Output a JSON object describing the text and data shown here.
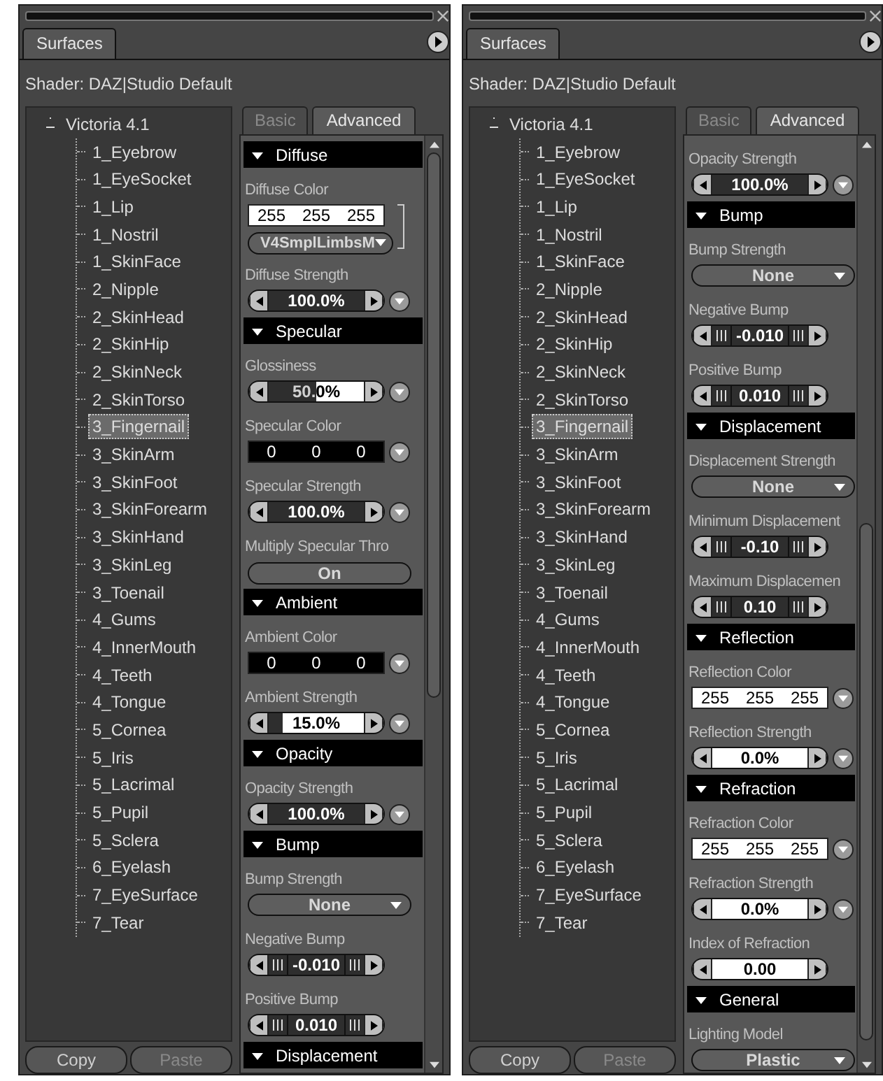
{
  "panels": [
    {
      "tab": {
        "label": "Surfaces",
        "selected": true
      },
      "shader": "Shader: DAZ|Studio Default",
      "tree": [
        {
          "label": "Victoria 4.1",
          "expanded": true,
          "selected": false,
          "children": [
            {
              "label": "1_Eyebrow",
              "selected": false
            },
            {
              "label": "1_EyeSocket",
              "selected": false
            },
            {
              "label": "1_Lip",
              "selected": false
            },
            {
              "label": "1_Nostril",
              "selected": false
            },
            {
              "label": "1_SkinFace",
              "selected": false
            },
            {
              "label": "2_Nipple",
              "selected": false
            },
            {
              "label": "2_SkinHead",
              "selected": false
            },
            {
              "label": "2_SkinHip",
              "selected": false
            },
            {
              "label": "2_SkinNeck",
              "selected": false
            },
            {
              "label": "2_SkinTorso",
              "selected": false
            },
            {
              "label": "3_Fingernail",
              "selected": true
            },
            {
              "label": "3_SkinArm",
              "selected": false
            },
            {
              "label": "3_SkinFoot",
              "selected": false
            },
            {
              "label": "3_SkinForearm",
              "selected": false
            },
            {
              "label": "3_SkinHand",
              "selected": false
            },
            {
              "label": "3_SkinLeg",
              "selected": false
            },
            {
              "label": "3_Toenail",
              "selected": false
            },
            {
              "label": "4_Gums",
              "selected": false
            },
            {
              "label": "4_InnerMouth",
              "selected": false
            },
            {
              "label": "4_Teeth",
              "selected": false
            },
            {
              "label": "4_Tongue",
              "selected": false
            },
            {
              "label": "5_Cornea",
              "selected": false
            },
            {
              "label": "5_Iris",
              "selected": false
            },
            {
              "label": "5_Lacrimal",
              "selected": false
            },
            {
              "label": "5_Pupil",
              "selected": false
            },
            {
              "label": "5_Sclera",
              "selected": false
            },
            {
              "label": "6_Eyelash",
              "selected": false
            },
            {
              "label": "7_EyeSurface",
              "selected": false
            },
            {
              "label": "7_Tear",
              "selected": false
            }
          ]
        }
      ],
      "prop_tabs": [
        {
          "label": "Basic",
          "selected": false
        },
        {
          "label": "Advanced",
          "selected": true
        }
      ],
      "properties": [
        {
          "kind": "section",
          "label": "Diffuse",
          "expanded": true
        },
        {
          "kind": "label",
          "label": "Diffuse Color"
        },
        {
          "kind": "color",
          "values": [
            "255",
            "255",
            "255"
          ],
          "color": "#ffffff",
          "menu": false
        },
        {
          "kind": "map",
          "value": "V4SmplLimbsM"
        },
        {
          "kind": "label",
          "label": "Diffuse Strength"
        },
        {
          "kind": "slider",
          "value": "100.0%",
          "level": 1,
          "menu": true
        },
        {
          "kind": "section",
          "label": "Specular",
          "expanded": true
        },
        {
          "kind": "label",
          "label": "Glossiness"
        },
        {
          "kind": "slider",
          "value": "50.0%",
          "level": 0.5,
          "menu": true
        },
        {
          "kind": "label",
          "label": "Specular Color"
        },
        {
          "kind": "color",
          "values": [
            "0",
            "0",
            "0"
          ],
          "color": "#000000",
          "menu": true
        },
        {
          "kind": "label",
          "label": "Specular Strength"
        },
        {
          "kind": "slider",
          "value": "100.0%",
          "level": 1,
          "menu": true
        },
        {
          "kind": "label",
          "label": "Multiply Specular Thro"
        },
        {
          "kind": "toggle",
          "value": "On"
        },
        {
          "kind": "section",
          "label": "Ambient",
          "expanded": true
        },
        {
          "kind": "label",
          "label": "Ambient Color"
        },
        {
          "kind": "color",
          "values": [
            "0",
            "0",
            "0"
          ],
          "color": "#000000",
          "menu": true
        },
        {
          "kind": "label",
          "label": "Ambient Strength"
        },
        {
          "kind": "slider",
          "value": "15.0%",
          "level": 0.15,
          "menu": true
        },
        {
          "kind": "section",
          "label": "Opacity",
          "expanded": true
        },
        {
          "kind": "label",
          "label": "Opacity Strength"
        },
        {
          "kind": "slider",
          "value": "100.0%",
          "level": 1,
          "menu": true
        },
        {
          "kind": "section",
          "label": "Bump",
          "expanded": true
        },
        {
          "kind": "label",
          "label": "Bump Strength"
        },
        {
          "kind": "dropdown",
          "value": "None"
        },
        {
          "kind": "label",
          "label": "Negative Bump"
        },
        {
          "kind": "stepper",
          "value": "-0.010"
        },
        {
          "kind": "label",
          "label": "Positive Bump"
        },
        {
          "kind": "stepper",
          "value": "0.010"
        },
        {
          "kind": "section",
          "label": "Displacement",
          "expanded": true
        }
      ],
      "buttons": [
        {
          "label": "Copy",
          "disabled": false
        },
        {
          "label": "Paste",
          "disabled": true
        }
      ]
    },
    {
      "tab": {
        "label": "Surfaces",
        "selected": true
      },
      "shader": "Shader: DAZ|Studio Default",
      "tree": [
        {
          "label": "Victoria 4.1",
          "expanded": true,
          "selected": false,
          "children": [
            {
              "label": "1_Eyebrow",
              "selected": false
            },
            {
              "label": "1_EyeSocket",
              "selected": false
            },
            {
              "label": "1_Lip",
              "selected": false
            },
            {
              "label": "1_Nostril",
              "selected": false
            },
            {
              "label": "1_SkinFace",
              "selected": false
            },
            {
              "label": "2_Nipple",
              "selected": false
            },
            {
              "label": "2_SkinHead",
              "selected": false
            },
            {
              "label": "2_SkinHip",
              "selected": false
            },
            {
              "label": "2_SkinNeck",
              "selected": false
            },
            {
              "label": "2_SkinTorso",
              "selected": false
            },
            {
              "label": "3_Fingernail",
              "selected": true
            },
            {
              "label": "3_SkinArm",
              "selected": false
            },
            {
              "label": "3_SkinFoot",
              "selected": false
            },
            {
              "label": "3_SkinForearm",
              "selected": false
            },
            {
              "label": "3_SkinHand",
              "selected": false
            },
            {
              "label": "3_SkinLeg",
              "selected": false
            },
            {
              "label": "3_Toenail",
              "selected": false
            },
            {
              "label": "4_Gums",
              "selected": false
            },
            {
              "label": "4_InnerMouth",
              "selected": false
            },
            {
              "label": "4_Teeth",
              "selected": false
            },
            {
              "label": "4_Tongue",
              "selected": false
            },
            {
              "label": "5_Cornea",
              "selected": false
            },
            {
              "label": "5_Iris",
              "selected": false
            },
            {
              "label": "5_Lacrimal",
              "selected": false
            },
            {
              "label": "5_Pupil",
              "selected": false
            },
            {
              "label": "5_Sclera",
              "selected": false
            },
            {
              "label": "6_Eyelash",
              "selected": false
            },
            {
              "label": "7_EyeSurface",
              "selected": false
            },
            {
              "label": "7_Tear",
              "selected": false
            }
          ]
        }
      ],
      "prop_tabs": [
        {
          "label": "Basic",
          "selected": false
        },
        {
          "label": "Advanced",
          "selected": true
        }
      ],
      "properties": [
        {
          "kind": "label",
          "label": "Opacity Strength"
        },
        {
          "kind": "slider",
          "value": "100.0%",
          "level": 1,
          "menu": true
        },
        {
          "kind": "section",
          "label": "Bump",
          "expanded": true
        },
        {
          "kind": "label",
          "label": "Bump Strength"
        },
        {
          "kind": "dropdown",
          "value": "None"
        },
        {
          "kind": "label",
          "label": "Negative Bump"
        },
        {
          "kind": "stepper",
          "value": "-0.010"
        },
        {
          "kind": "label",
          "label": "Positive Bump"
        },
        {
          "kind": "stepper",
          "value": "0.010"
        },
        {
          "kind": "section",
          "label": "Displacement",
          "expanded": true
        },
        {
          "kind": "label",
          "label": "Displacement Strength"
        },
        {
          "kind": "dropdown",
          "value": "None"
        },
        {
          "kind": "label",
          "label": "Minimum Displacement"
        },
        {
          "kind": "stepper",
          "value": "-0.10"
        },
        {
          "kind": "label",
          "label": "Maximum Displacemen"
        },
        {
          "kind": "stepper",
          "value": "0.10"
        },
        {
          "kind": "section",
          "label": "Reflection",
          "expanded": true
        },
        {
          "kind": "label",
          "label": "Reflection Color"
        },
        {
          "kind": "color",
          "values": [
            "255",
            "255",
            "255"
          ],
          "color": "#ffffff",
          "menu": true
        },
        {
          "kind": "label",
          "label": "Reflection Strength"
        },
        {
          "kind": "slider",
          "value": "0.0%",
          "level": 0,
          "menu": true
        },
        {
          "kind": "section",
          "label": "Refraction",
          "expanded": true
        },
        {
          "kind": "label",
          "label": "Refraction Color"
        },
        {
          "kind": "color",
          "values": [
            "255",
            "255",
            "255"
          ],
          "color": "#ffffff",
          "menu": true
        },
        {
          "kind": "label",
          "label": "Refraction Strength"
        },
        {
          "kind": "slider",
          "value": "0.0%",
          "level": 0,
          "menu": true
        },
        {
          "kind": "label",
          "label": "Index of Refraction"
        },
        {
          "kind": "slider",
          "value": "0.00",
          "level": 0,
          "menu": false
        },
        {
          "kind": "section",
          "label": "General",
          "expanded": true
        },
        {
          "kind": "label",
          "label": "Lighting Model"
        },
        {
          "kind": "dropdown",
          "value": "Plastic"
        }
      ],
      "buttons": [
        {
          "label": "Copy",
          "disabled": false
        },
        {
          "label": "Paste",
          "disabled": true
        }
      ]
    }
  ]
}
